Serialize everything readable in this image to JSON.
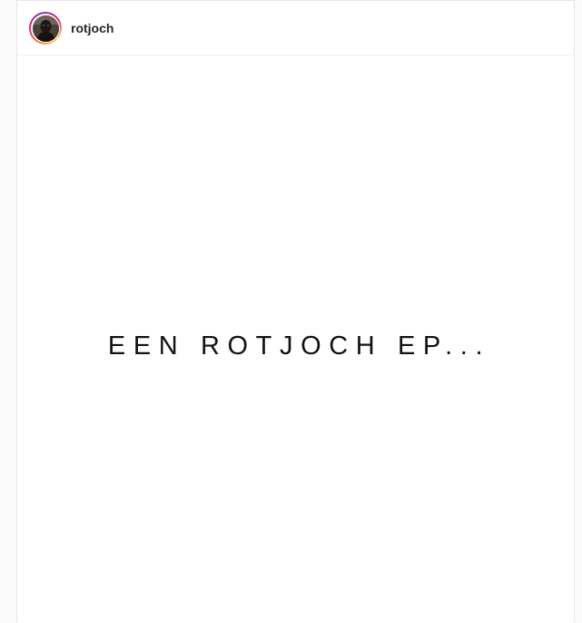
{
  "post": {
    "username": "rotjoch",
    "image_text": "EEN ROTJOCH EP..."
  },
  "colors": {
    "background": "#fafafa",
    "card": "#ffffff",
    "border": "#e6e6e6",
    "username": "#262626",
    "story_ring": [
      "#f58529",
      "#dd2a7b",
      "#8134af"
    ]
  },
  "icons": {
    "avatar": "profile-photo"
  }
}
